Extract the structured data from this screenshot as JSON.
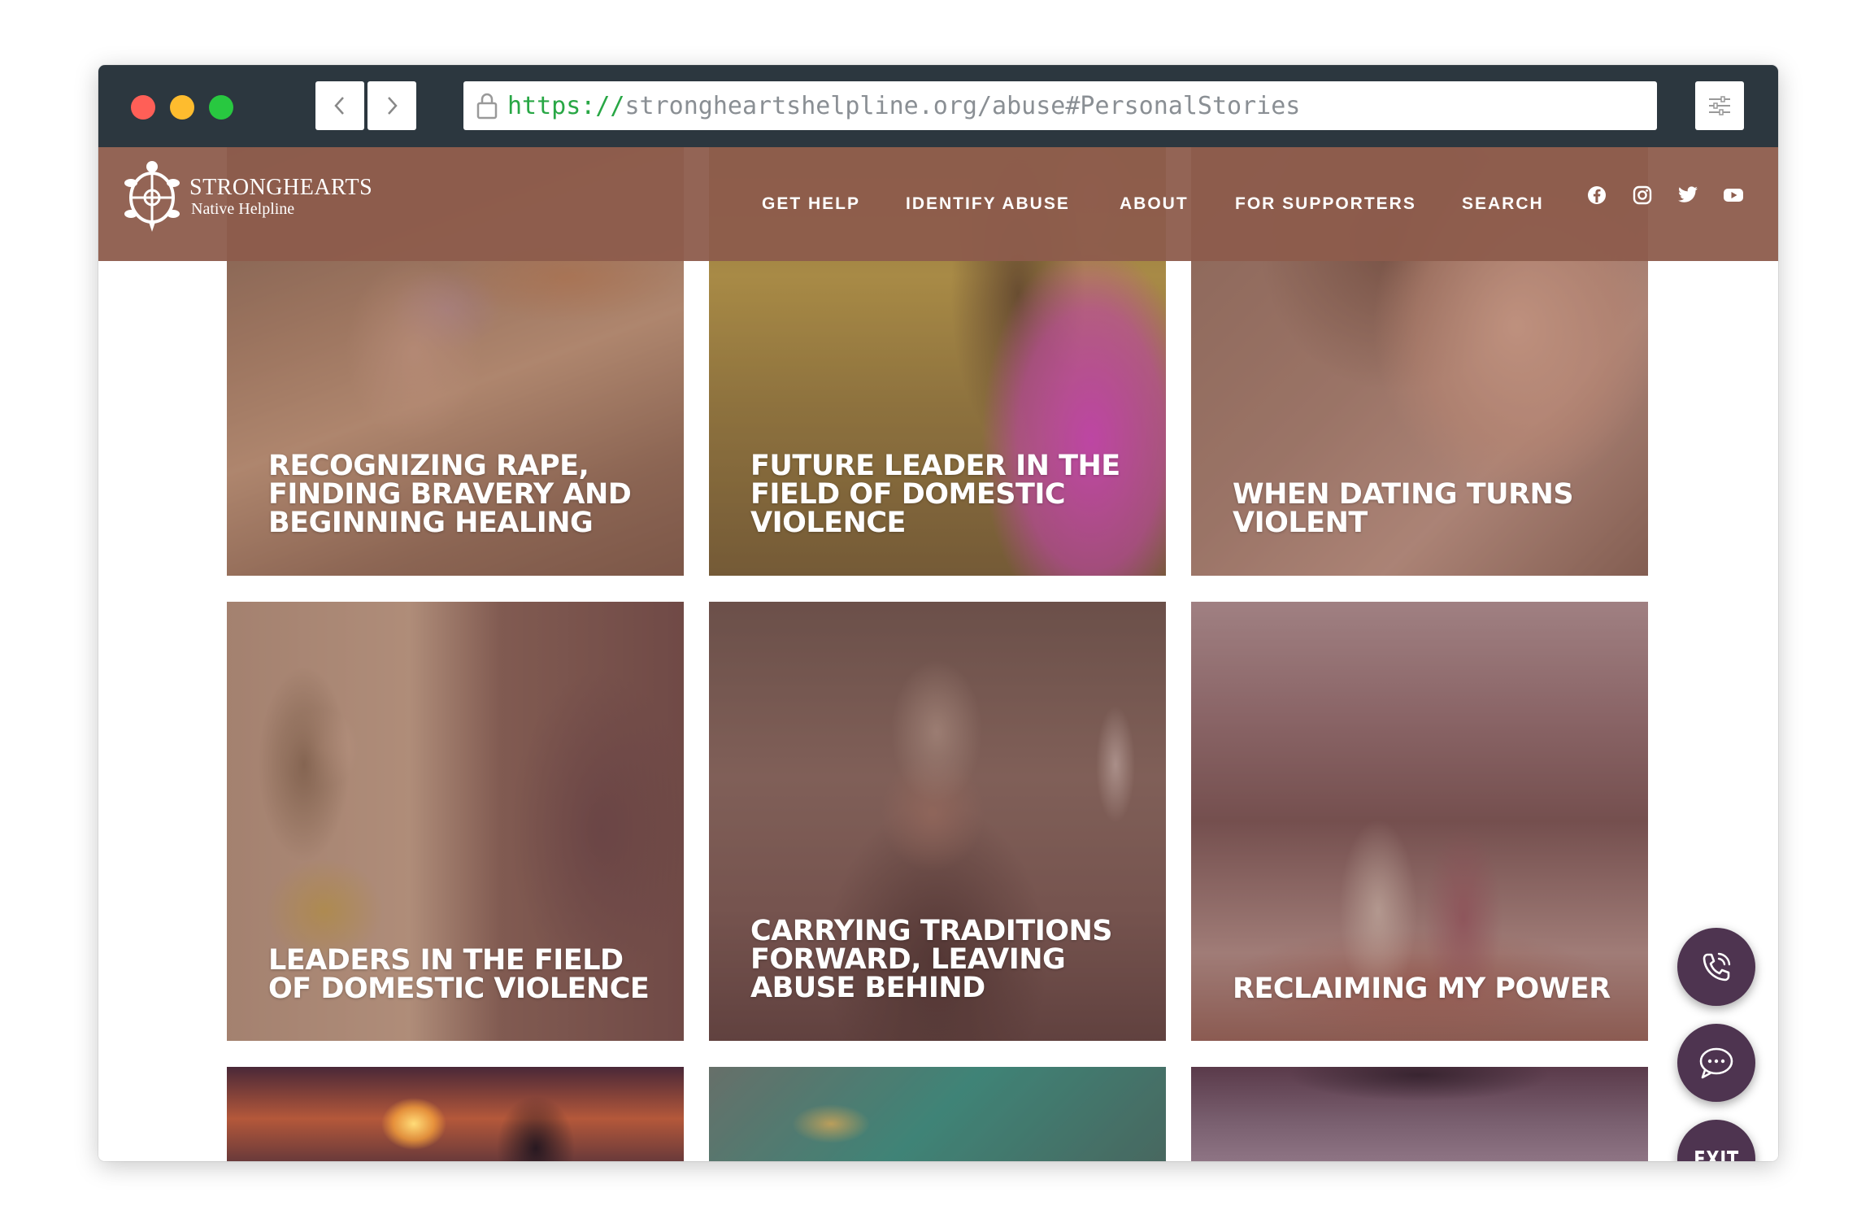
{
  "browser": {
    "url_scheme": "https://",
    "url_rest": "strongheartshelpline.org/abuse#PersonalStories"
  },
  "site": {
    "logo_title": "STRONGHEARTS",
    "logo_subtitle": "Native Helpline",
    "nav": [
      "GET HELP",
      "IDENTIFY ABUSE",
      "ABOUT",
      "FOR SUPPORTERS",
      "SEARCH"
    ],
    "social_icons": [
      "facebook-icon",
      "instagram-icon",
      "twitter-icon",
      "youtube-icon"
    ],
    "header_color": "#8d5c4c"
  },
  "stories": [
    {
      "title": "RECOGNIZING RAPE, FINDING BRAVERY AND BEGINNING HEALING"
    },
    {
      "title": "FUTURE LEADER IN THE FIELD OF DOMESTIC VIOLENCE"
    },
    {
      "title": "WHEN DATING TURNS VIOLENT"
    },
    {
      "title": "LEADERS IN THE FIELD OF DOMESTIC VIOLENCE"
    },
    {
      "title": "CARRYING TRADITIONS FORWARD, LEAVING ABUSE BEHIND"
    },
    {
      "title": "RECLAIMING MY POWER"
    }
  ],
  "floating": {
    "exit_label": "EXIT",
    "button_color": "#4e3450"
  }
}
